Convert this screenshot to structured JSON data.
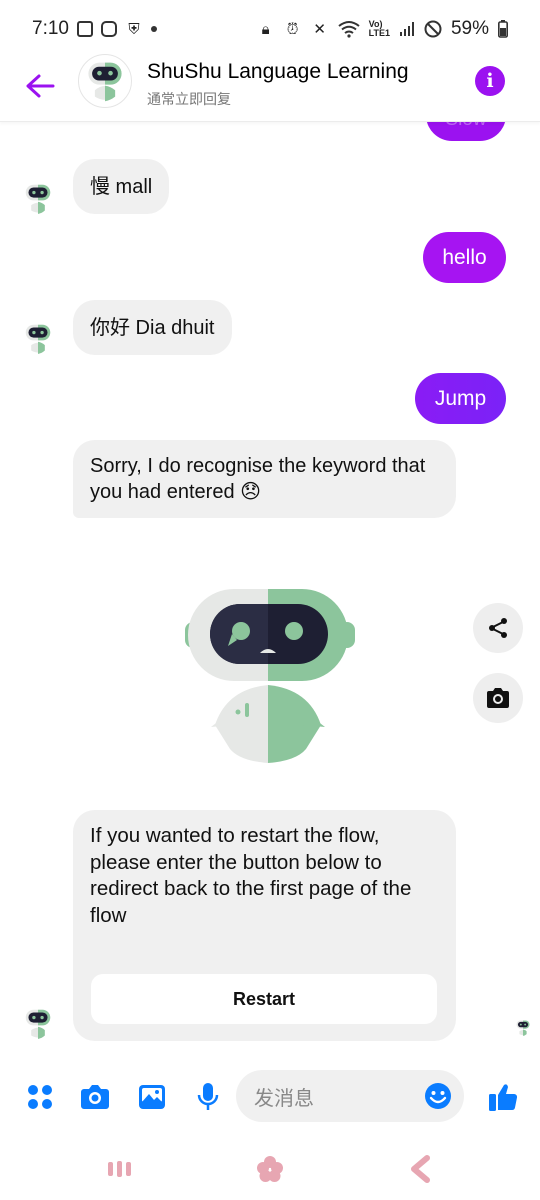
{
  "status_bar": {
    "time": "7:10",
    "battery": "59%"
  },
  "header": {
    "title": "ShuShu Language Learning",
    "subtitle": "通常立即回复"
  },
  "messages": {
    "partial_sent": "Slow",
    "bot_1": "慢 mall",
    "user_1": "hello",
    "bot_2": "你好 Dia dhuit",
    "user_2": "Jump",
    "bot_3": "Sorry, I do recognise the keyword that you had entered 😞",
    "bot_4": "If you wanted to restart the flow, please enter the button below to redirect back to the first page of the flow",
    "restart_label": "Restart"
  },
  "composer": {
    "placeholder": "发消息"
  },
  "colors": {
    "accent_purple": "#9b12f0",
    "messenger_blue": "#0a7cff",
    "bubble_in": "#f0f0f0",
    "bot_green": "#8cc59c"
  },
  "icons": {
    "back": "arrow-left-icon",
    "info": "info-icon",
    "share": "share-icon",
    "camera_side": "camera-icon",
    "menu": "four-dots-icon",
    "camera": "camera-icon",
    "gallery": "image-icon",
    "mic": "microphone-icon",
    "emoji": "smiley-icon",
    "like": "thumbs-up-icon",
    "nav_recent": "recents-icon",
    "nav_home": "home-icon",
    "nav_back": "back-nav-icon"
  }
}
